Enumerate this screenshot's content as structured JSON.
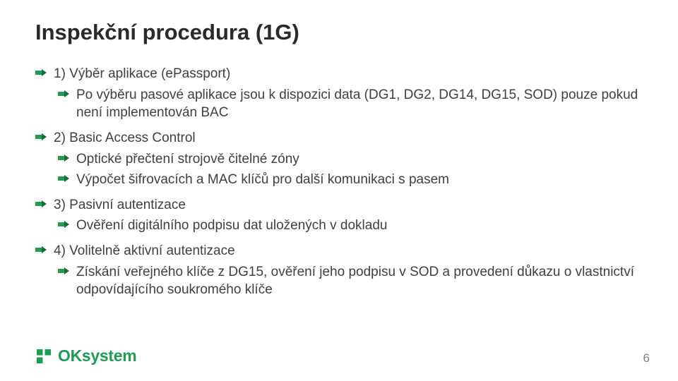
{
  "title": "Inspekční procedura (1G)",
  "items": [
    {
      "level": 1,
      "text": "1) Výběr aplikace (ePassport)"
    },
    {
      "level": 2,
      "text": "Po výběru pasové aplikace jsou k dispozici data (DG1, DG2, DG14, DG15, SOD) pouze pokud není implementován BAC"
    },
    {
      "level": 1,
      "text": "2) Basic Access Control"
    },
    {
      "level": 2,
      "text": "Optické přečtení strojově čitelné zóny"
    },
    {
      "level": 2,
      "text": "Výpočet šifrovacích a MAC klíčů pro další komunikaci s pasem"
    },
    {
      "level": 1,
      "text": "3) Pasivní autentizace"
    },
    {
      "level": 2,
      "text": "Ověření digitálního podpisu dat uložených v dokladu"
    },
    {
      "level": 1,
      "text": "4) Volitelně aktivní autentizace"
    },
    {
      "level": 2,
      "text": "Získání veřejného klíče z DG15, ověření jeho podpisu v SOD a provedení důkazu o vlastnictví odpovídajícího soukromého klíče"
    }
  ],
  "footer": {
    "brand": "OKsystem"
  },
  "page_number": "6",
  "colors": {
    "accent": "#1f9b52",
    "accent_dark": "#0f6f3a"
  }
}
